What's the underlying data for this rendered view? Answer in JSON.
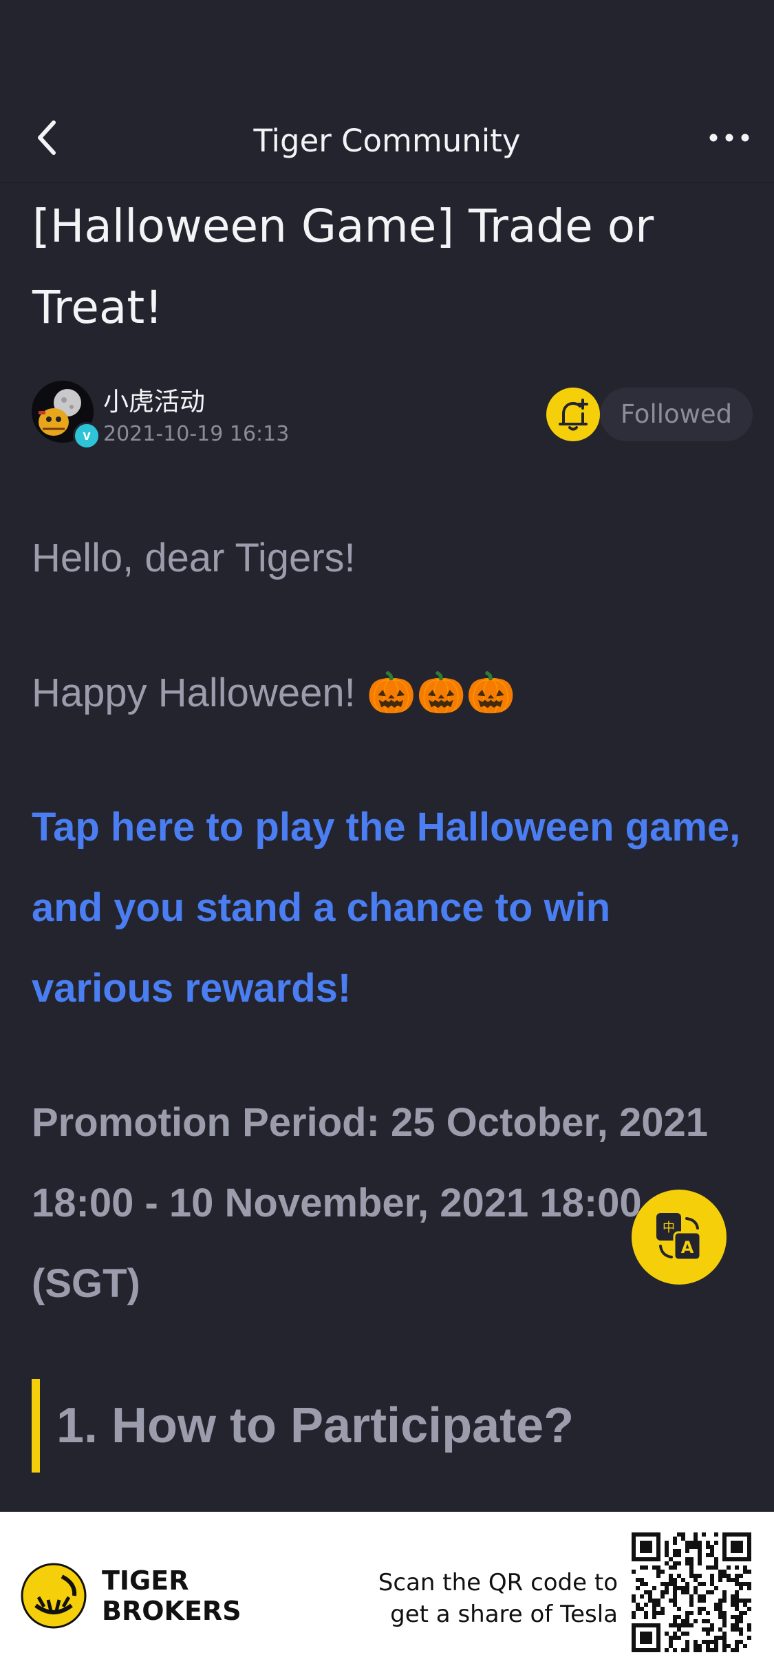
{
  "nav": {
    "title": "Tiger Community"
  },
  "post": {
    "title": "[Halloween Game] Trade or Treat!",
    "author_name": "小虎活动",
    "date": "2021-10-19 16:13",
    "follow_label": "Followed"
  },
  "body": {
    "greeting": "Hello, dear Tigers!",
    "halloween": "Happy Halloween! 🎃🎃🎃",
    "link": "Tap here to play the Halloween game, and you stand a chance to win various rewards!",
    "promo": "Promotion Period: 25 October, 2021 18:00 - 10 November, 2021 18:00 (SGT)",
    "section_title": "1. How to Participate?"
  },
  "footer": {
    "brand_line1": "TIGER",
    "brand_line2": "BROKERS",
    "scan_line1": "Scan the QR code to",
    "scan_line2": "get a share of Tesla"
  },
  "colors": {
    "background": "#23242e",
    "accent_yellow": "#f6cf0b",
    "link_blue": "#4a7ef2",
    "muted_text": "#9c9dac"
  },
  "icons": [
    "back-arrow-icon",
    "more-icon",
    "bell-plus-icon",
    "verified-icon",
    "translate-icon",
    "tiger-logo-icon",
    "qr-code-icon"
  ]
}
